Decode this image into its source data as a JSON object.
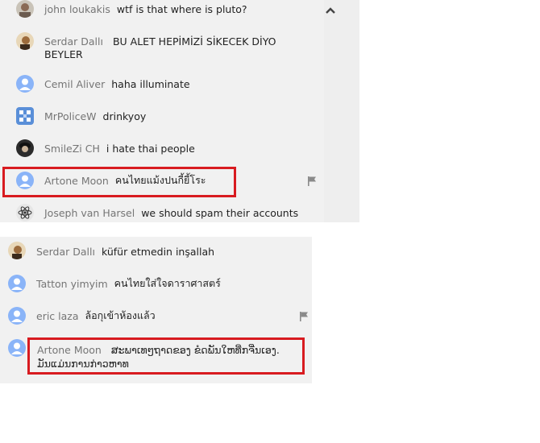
{
  "chat_top": {
    "messages": [
      {
        "author": "john loukakis",
        "text": "wtf is that where is pluto?",
        "avatar": "photo-john"
      },
      {
        "author": "Serdar Dallı",
        "text": "BU ALET HEPİMİZİ SİKECEK DİYO",
        "text2": "BEYLER",
        "avatar": "photo-serdar"
      },
      {
        "author": "Cemil Aliver",
        "text": "haha illuminate",
        "avatar": "default-user"
      },
      {
        "author": "MrPoliceW",
        "text": "drinkyoy",
        "avatar": "blue-square-pattern"
      },
      {
        "author": "SmileZi CH",
        "text": "i hate thai people",
        "avatar": "photo-dark-hat"
      },
      {
        "author": "Artone Moon",
        "text": "คนไทยแม้งปนกี้ยี้โระ",
        "avatar": "default-user",
        "highlighted": true,
        "has_flag": true
      },
      {
        "author": "Joseph van Harsel",
        "text": "we should spam their accounts",
        "avatar": "atom-symbol"
      }
    ]
  },
  "chat_bottom": {
    "messages": [
      {
        "author": "Serdar Dallı",
        "text": "küfür etmedin inşallah",
        "avatar": "photo-serdar"
      },
      {
        "author": "Tatton yimyim",
        "text": "คนไทยใส่ใจดาราศาสตร์",
        "avatar": "default-user"
      },
      {
        "author": "eric laza",
        "text": "ล้อกุเข้าห้องแล้ว",
        "avatar": "default-user",
        "has_flag": true
      },
      {
        "author": "Artone Moon",
        "text": "ສະພາເທໆຖາດຂອງ ຂໍດພັນໃຫທີ່ກຈີ່ນເອງ.",
        "text2": "ມັນແມ່ນການກ່າວຫາທ",
        "avatar": "default-user",
        "highlighted": true
      }
    ]
  },
  "colors": {
    "highlight": "#d81b20",
    "panel": "#f1f1f1",
    "author": "#757575",
    "avatar": "#8ab4f8"
  }
}
